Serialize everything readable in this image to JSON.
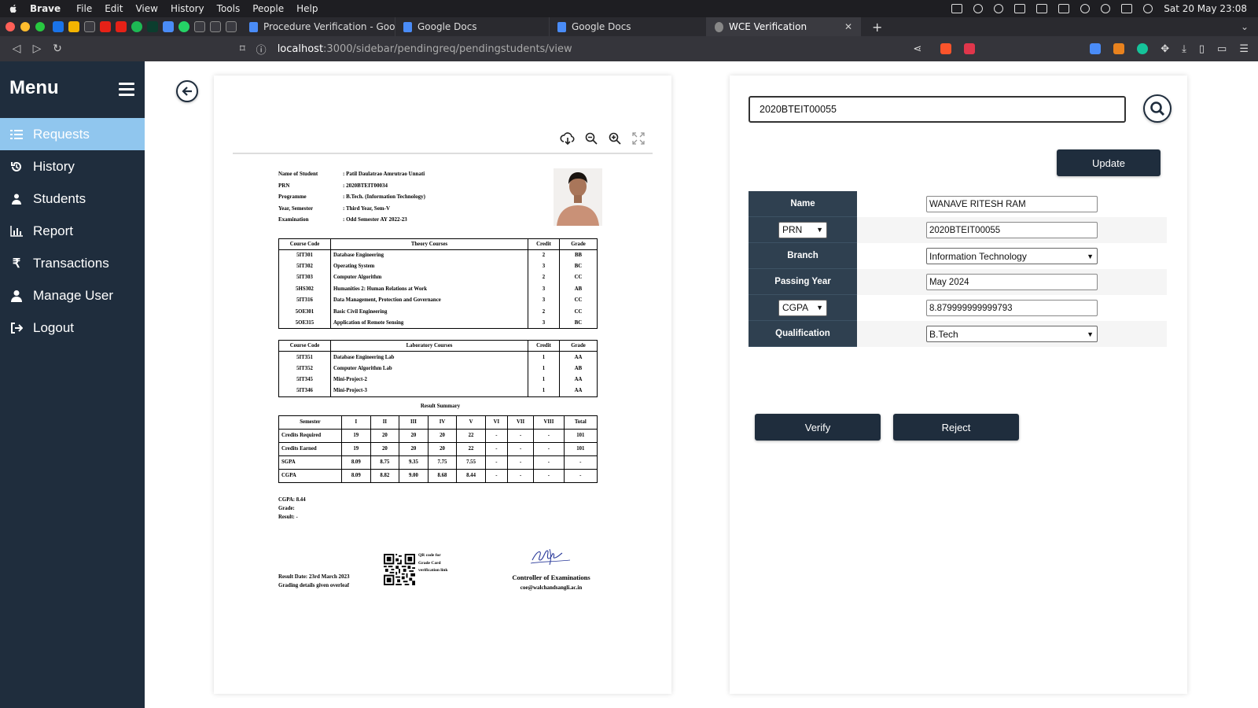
{
  "menubar": {
    "app": "Brave",
    "items": [
      "File",
      "Edit",
      "View",
      "History",
      "Tools",
      "People",
      "Help"
    ],
    "datetime": "Sat 20 May 23:08"
  },
  "tabs": [
    {
      "title": "Procedure Verification - Google Do"
    },
    {
      "title": "Google Docs"
    },
    {
      "title": "Google Docs"
    },
    {
      "title": "WCE Verification",
      "active": true
    }
  ],
  "address": {
    "host": "localhost",
    "path": ":3000/sidebar/pendingreq/pendingstudents/view"
  },
  "sidebar": {
    "title": "Menu",
    "items": [
      {
        "label": "Requests",
        "icon": "list-icon",
        "active": true
      },
      {
        "label": "History",
        "icon": "history-icon"
      },
      {
        "label": "Students",
        "icon": "students-icon"
      },
      {
        "label": "Report",
        "icon": "chart-icon"
      },
      {
        "label": "Transactions",
        "icon": "rupee-icon"
      },
      {
        "label": "Manage User",
        "icon": "user-icon"
      },
      {
        "label": "Logout",
        "icon": "logout-icon"
      }
    ]
  },
  "gradecard": {
    "info": [
      {
        "label": "Name of Student",
        "value": ": Patil Daulatrao Amrutrao Unnati"
      },
      {
        "label": "PRN",
        "value": ": 2020BTEIT00034"
      },
      {
        "label": "Programme",
        "value": ": B.Tech. (Information Technology)"
      },
      {
        "label": "Year, Semester",
        "value": ": Third Year, Sem-V"
      },
      {
        "label": "Examination",
        "value": ": Odd Semester AY 2022-23"
      }
    ],
    "theory_headers": [
      "Course Code",
      "Theory Courses",
      "Credit",
      "Grade"
    ],
    "theory": [
      [
        "5IT301",
        "Database Engineering",
        "2",
        "BB"
      ],
      [
        "5IT302",
        "Operating System",
        "3",
        "BC"
      ],
      [
        "5IT303",
        "Computer Algorithm",
        "2",
        "CC"
      ],
      [
        "5HS302",
        "Humanities 2: Human Relations at Work",
        "3",
        "AB"
      ],
      [
        "5IT316",
        "Data Management, Protection and Governance",
        "3",
        "CC"
      ],
      [
        "5OE301",
        "Basic Civil Engineering",
        "2",
        "CC"
      ],
      [
        "5OE315",
        "Application of Remote Sensing",
        "3",
        "BC"
      ]
    ],
    "lab_headers": [
      "Course Code",
      "Laboratory Courses",
      "Credit",
      "Grade"
    ],
    "lab": [
      [
        "5IT351",
        "Database Engineering Lab",
        "1",
        "AA"
      ],
      [
        "5IT352",
        "Computer Algorithm Lab",
        "1",
        "AB"
      ],
      [
        "5IT345",
        "Mini-Project-2",
        "1",
        "AA"
      ],
      [
        "5IT346",
        "Mini-Project-3",
        "1",
        "AA"
      ]
    ],
    "summary_title": "Result Summary",
    "summary_headers": [
      "Semester",
      "I",
      "II",
      "III",
      "IV",
      "V",
      "VI",
      "VII",
      "VIII",
      "Total"
    ],
    "summary": [
      [
        "Credits Required",
        "19",
        "20",
        "20",
        "20",
        "22",
        "-",
        "-",
        "-",
        "101"
      ],
      [
        "Credits Earned",
        "19",
        "20",
        "20",
        "20",
        "22",
        "-",
        "-",
        "-",
        "101"
      ],
      [
        "SGPA",
        "8.09",
        "8.75",
        "9.35",
        "7.75",
        "7.55",
        "-",
        "-",
        "-",
        "-"
      ],
      [
        "CGPA",
        "8.09",
        "8.82",
        "9.00",
        "8.68",
        "8.44",
        "-",
        "-",
        "-",
        "-"
      ]
    ],
    "cgpa_line": "CGPA:   8.44",
    "grade_line": "Grade:",
    "result_line": "Result:   -",
    "result_date": "Result Date: 23rd March 2023",
    "grading_details": "Grading details given overleaf",
    "qr_text": "QR code for Grade Card verification link",
    "coe_title": "Controller of Examinations",
    "coe_email": "coe@walchandsangli.ac.in"
  },
  "form": {
    "search_value": "2020BTEIT00055",
    "update_label": "Update",
    "rows": [
      {
        "label": "Name",
        "value": "WANAVE RITESH RAM",
        "kind": "input"
      },
      {
        "label": "PRN",
        "value": "2020BTEIT00055",
        "kind": "input",
        "label_select": true
      },
      {
        "label": "Branch",
        "value": "Information Technology",
        "kind": "select"
      },
      {
        "label": "Passing Year",
        "value": "May 2024",
        "kind": "input"
      },
      {
        "label": "CGPA",
        "value": "8.879999999999793",
        "kind": "input",
        "label_select": true
      },
      {
        "label": "Qualification",
        "value": "B.Tech",
        "kind": "select"
      }
    ],
    "verify_label": "Verify",
    "reject_label": "Reject"
  }
}
